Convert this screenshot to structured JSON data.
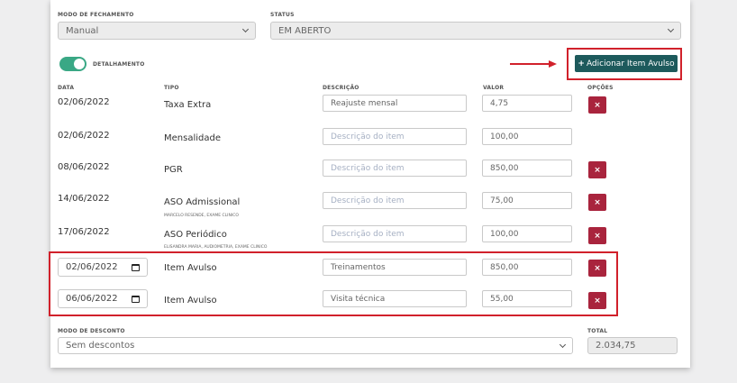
{
  "top": {
    "modo_fechamento_label": "MODO DE FECHAMENTO",
    "modo_fechamento_value": "Manual",
    "status_label": "STATUS",
    "status_value": "EM ABERTO"
  },
  "toggle": {
    "label": "DETALHAMENTO",
    "on": true
  },
  "add_button": {
    "icon": "+",
    "label": "Adicionar Item Avulso"
  },
  "headers": {
    "data": "DATA",
    "tipo": "TIPO",
    "descricao": "DESCRIÇÃO",
    "valor": "VALOR",
    "opcoes": "OPÇÕES"
  },
  "rows": [
    {
      "date": "02/06/2022",
      "tipo": "Taxa Extra",
      "sub": "",
      "descricao": "Reajuste mensal",
      "descricao_is_placeholder": false,
      "valor": "4,75",
      "delete": true
    },
    {
      "date": "02/06/2022",
      "tipo": "Mensalidade",
      "sub": "",
      "descricao": "Descrição do item",
      "descricao_is_placeholder": true,
      "valor": "100,00",
      "delete": false
    },
    {
      "date": "08/06/2022",
      "tipo": "PGR",
      "sub": "",
      "descricao": "Descrição do item",
      "descricao_is_placeholder": true,
      "valor": "850,00",
      "delete": true
    },
    {
      "date": "14/06/2022",
      "tipo": "ASO Admissional",
      "sub": "MARCELO RESENDE, EXAME CLINICO",
      "descricao": "Descrição do item",
      "descricao_is_placeholder": true,
      "valor": "75,00",
      "delete": true
    },
    {
      "date": "17/06/2022",
      "tipo": "ASO Periódico",
      "sub": "ELISANDRA MARIA, AUDIOMETRIA, EXAME CLINICO",
      "descricao": "Descrição do item",
      "descricao_is_placeholder": true,
      "valor": "100,00",
      "delete": true
    }
  ],
  "avulso_rows": [
    {
      "date": "02/06/2022",
      "tipo": "Item Avulso",
      "descricao": "Treinamentos",
      "valor": "850,00"
    },
    {
      "date": "06/06/2022",
      "tipo": "Item Avulso",
      "descricao": "Visita técnica",
      "valor": "55,00"
    }
  ],
  "delete_glyph": "×",
  "footer": {
    "modo_desconto_label": "MODO DE DESCONTO",
    "modo_desconto_value": "Sem descontos",
    "total_label": "TOTAL",
    "total_value": "2.034,75"
  },
  "colors": {
    "toggle": "#3aa885",
    "delete": "#a9243d",
    "add_button": "#1d5a5c",
    "highlight": "#d1212b"
  }
}
